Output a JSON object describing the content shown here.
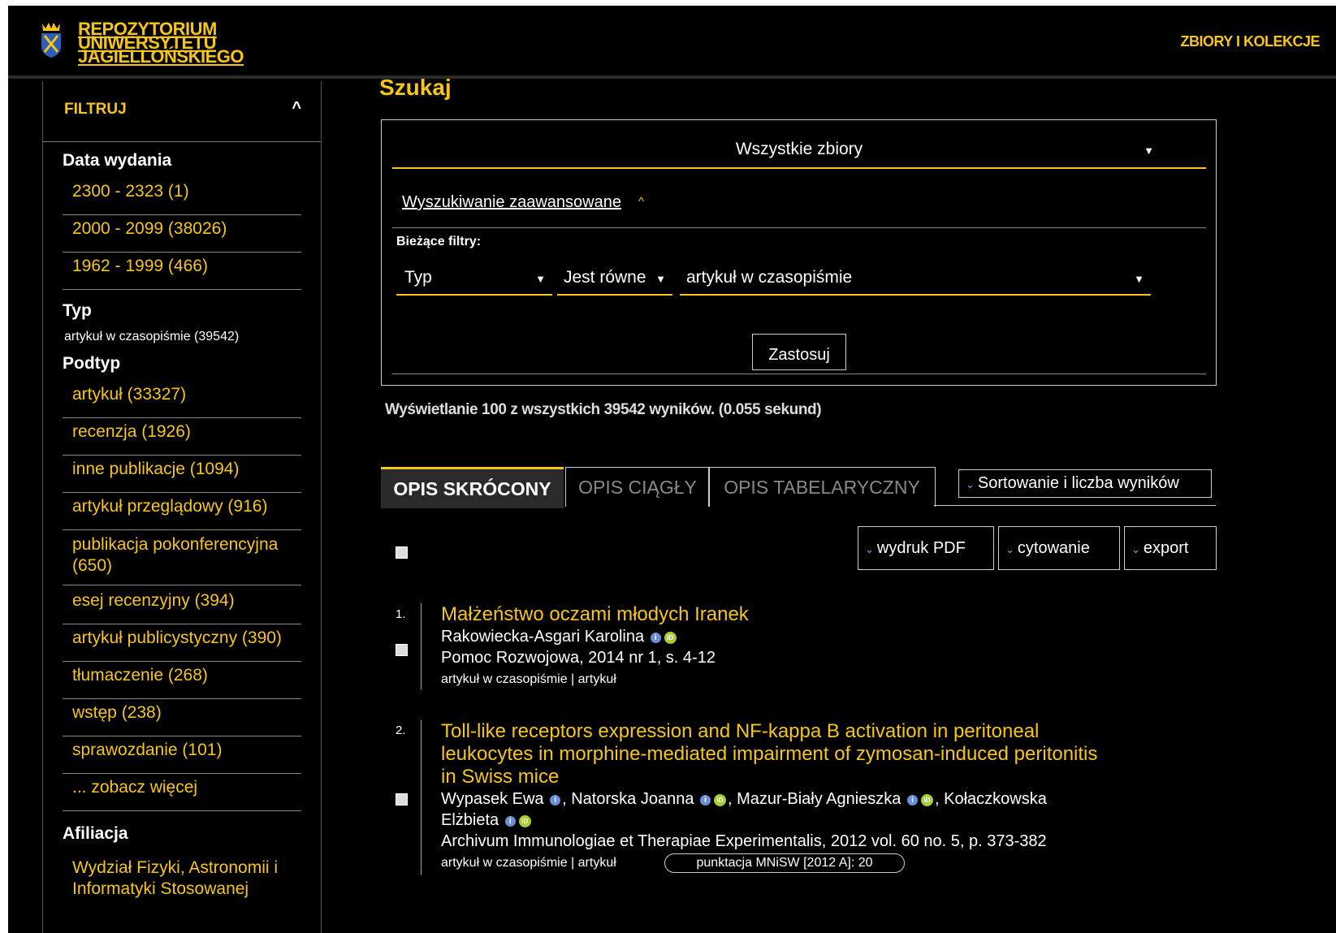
{
  "header": {
    "logo_lines": [
      "REPOZYTORIUM",
      "UNIWERSYTETU",
      "JAGIELLOŃSKIEGO"
    ],
    "top_link": "ZBIORY I KOLEKCJE"
  },
  "sidebar": {
    "filter_title": "FILTRUJ",
    "data_wydania": {
      "title": "Data wydania",
      "items": [
        "2300 - 2323 (1)",
        "2000 - 2099 (38026)",
        "1962 - 1999 (466)"
      ]
    },
    "typ": {
      "title": "Typ",
      "value": "artykuł w czasopiśmie (39542)"
    },
    "podtyp": {
      "title": "Podtyp",
      "items": [
        "artykuł (33327)",
        "recenzja (1926)",
        "inne publikacje (1094)",
        "artykuł przeglądowy (916)",
        "publikacja pokonferencyjna (650)",
        "esej recenzyjny (394)",
        "artykuł publicystyczny (390)",
        "tłumaczenie (268)",
        "wstęp (238)",
        "sprawozdanie (101)",
        "... zobacz więcej"
      ]
    },
    "afiliacja": {
      "title": "Afiliacja",
      "items": [
        "Wydział Fizyki, Astronomii i Informatyki Stosowanej"
      ]
    }
  },
  "main": {
    "title": "Szukaj",
    "collection": "Wszystkie zbiory",
    "advanced_link": "Wyszukiwanie zaawansowane",
    "current_filters_label": "Bieżące filtry:",
    "filter": {
      "field": "Typ",
      "operator": "Jest równe",
      "value": "artykuł w czasopiśmie"
    },
    "apply_label": "Zastosuj",
    "results_info": "Wyświetlanie 100 z wszystkich 39542 wyników. (0.055 sekund)",
    "tabs": [
      "OPIS SKRÓCONY",
      "OPIS CIĄGŁY",
      "OPIS TABELARYCZNY"
    ],
    "sort_label": "Sortowanie i liczba wyników",
    "actions": [
      "wydruk PDF",
      "cytowanie",
      "export"
    ]
  },
  "records": [
    {
      "num": "1.",
      "title": "Małżeństwo oczami młodych Iranek",
      "author": "Rakowiecka-Asgari Karolina",
      "source": "Pomoc Rozwojowa, 2014 nr 1, s. 4-12",
      "type": "artykuł w czasopiśmie | artykuł"
    },
    {
      "num": "2.",
      "title": "Toll-like receptors expression and NF-kappa B activation in peritoneal leukocytes in morphine-mediated impairment of zymosan-induced peritonitis in Swiss mice",
      "authors": [
        "Wypasek Ewa",
        "Natorska Joanna",
        "Mazur-Biały Agnieszka",
        "Kołaczkowska",
        "Elżbieta"
      ],
      "source": "Archivum Immunologiae et Therapiae Experimentalis, 2012 vol. 60 no. 5, p. 373-382",
      "type": "artykuł w czasopiśmie | artykuł",
      "badge": "punktacja MNiSW [2012 A]: 20"
    }
  ],
  "colors": {
    "accent": "#f5c518",
    "background": "#000000",
    "info_icon": "#6a8fd6",
    "orcid": "#a6ce39"
  }
}
